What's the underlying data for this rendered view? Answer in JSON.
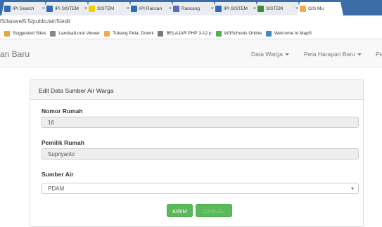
{
  "browser": {
    "tabs": [
      {
        "title": "IPI Search",
        "favicon_color": "#2d6db5"
      },
      {
        "title": "IPI SISTEM",
        "favicon_color": "#2d6db5"
      },
      {
        "title": "SISTEM",
        "favicon_color": "#f5d000"
      },
      {
        "title": "IPI Rancan",
        "favicon_color": "#2d6db5"
      },
      {
        "title": "Rancang",
        "favicon_color": "#5c6bc0"
      },
      {
        "title": "IPI SISTEM",
        "favicon_color": "#2d6db5"
      },
      {
        "title": "SISTEM",
        "favicon_color": "#3a8a3a"
      },
      {
        "title": "GIS Mu",
        "favicon_color": "#f0ad4e",
        "active": true
      }
    ],
    "address": "lS/laravel5.5/public/air/5/edit",
    "bookmarks": [
      {
        "label": "Suggested Sites",
        "icon_color": "#e8a33d"
      },
      {
        "label": "LandsatLook Viewer",
        "icon_color": "#888888"
      },
      {
        "label": "Tukang Peta: Downl",
        "icon_color": "#f0ad4e"
      },
      {
        "label": "BELAJAR PHP 3-12 p",
        "icon_color": "#7a7a7a"
      },
      {
        "label": "W3Schools Online",
        "icon_color": "#4caf50"
      },
      {
        "label": "Welcome to MapS",
        "icon_color": "#3c8dbc"
      }
    ]
  },
  "navbar": {
    "brand": "an Baru",
    "items": [
      {
        "label": "Data Warga"
      },
      {
        "label": "Peta Harapan Baru"
      },
      {
        "label": "Pe"
      }
    ]
  },
  "form": {
    "heading": "Edit Data Sumber Air Warga",
    "nomor_rumah": {
      "label": "Nomor Rumah",
      "value": "16"
    },
    "pemilik_rumah": {
      "label": "Pemilik Rumah",
      "value": "Supriyanto"
    },
    "sumber_air": {
      "label": "Sumber Air",
      "value": "PDAM"
    },
    "submit_label": "KIRIM",
    "cancel_label": "CANCEL"
  }
}
